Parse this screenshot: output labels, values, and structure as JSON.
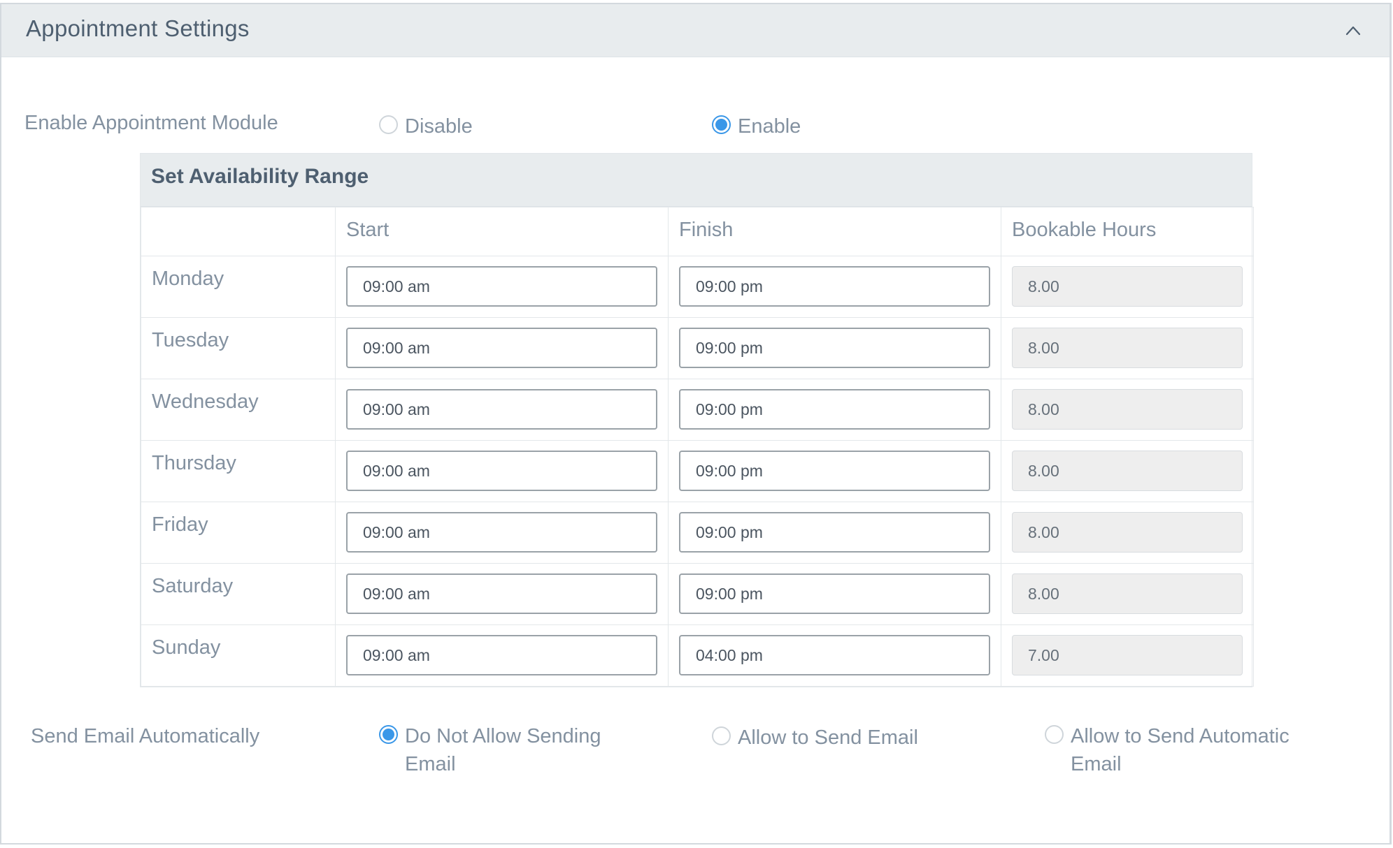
{
  "panel": {
    "title": "Appointment Settings"
  },
  "module": {
    "label": "Enable Appointment Module",
    "options": [
      {
        "label": "Disable",
        "checked": false
      },
      {
        "label": "Enable",
        "checked": true
      }
    ]
  },
  "availability": {
    "title": "Set Availability Range",
    "columns": [
      "",
      "Start",
      "Finish",
      "Bookable Hours"
    ],
    "rows": [
      {
        "day": "Monday",
        "start": "09:00 am",
        "finish": "09:00 pm",
        "hours": "8.00"
      },
      {
        "day": "Tuesday",
        "start": "09:00 am",
        "finish": "09:00 pm",
        "hours": "8.00"
      },
      {
        "day": "Wednesday",
        "start": "09:00 am",
        "finish": "09:00 pm",
        "hours": "8.00"
      },
      {
        "day": "Thursday",
        "start": "09:00 am",
        "finish": "09:00 pm",
        "hours": "8.00"
      },
      {
        "day": "Friday",
        "start": "09:00 am",
        "finish": "09:00 pm",
        "hours": "8.00"
      },
      {
        "day": "Saturday",
        "start": "09:00 am",
        "finish": "09:00 pm",
        "hours": "8.00"
      },
      {
        "day": "Sunday",
        "start": "09:00 am",
        "finish": "04:00 pm",
        "hours": "7.00"
      }
    ]
  },
  "email": {
    "label": "Send Email Automatically",
    "options": [
      {
        "line1": "Do Not Allow Sending",
        "line2": "Email",
        "checked": true
      },
      {
        "line1": "Allow to Send Email",
        "line2": "",
        "checked": false
      },
      {
        "line1": "Allow to Send Automatic",
        "line2": "Email",
        "checked": false
      }
    ]
  },
  "colors": {
    "accent": "#3a97e8",
    "header_bg": "#e8ecee",
    "title_text": "#4e5f70",
    "label_text": "#8391a0"
  },
  "icons": {
    "collapse": "chevron-up-icon"
  }
}
